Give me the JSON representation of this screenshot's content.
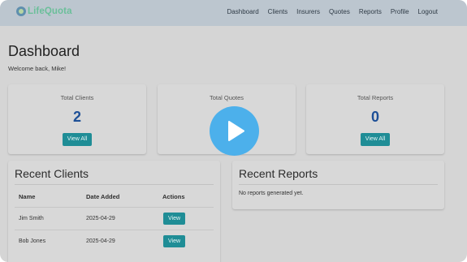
{
  "nav": {
    "logo": "LifeQuota",
    "links": [
      "Dashboard",
      "Clients",
      "Insurers",
      "Quotes",
      "Reports",
      "Profile",
      "Logout"
    ]
  },
  "page": {
    "title": "Dashboard",
    "welcome": "Welcome back, Mike!"
  },
  "stats": [
    {
      "label": "Total Clients",
      "value": "2",
      "button": "View All"
    },
    {
      "label": "Total Quotes",
      "value": "",
      "button": ""
    },
    {
      "label": "Total Reports",
      "value": "0",
      "button": "View All"
    }
  ],
  "recent_clients": {
    "title": "Recent Clients",
    "columns": [
      "Name",
      "Date Added",
      "Actions"
    ],
    "rows": [
      {
        "name": "Jim Smith",
        "date": "2025-04-29",
        "action": "View"
      },
      {
        "name": "Bob Jones",
        "date": "2025-04-29",
        "action": "View"
      }
    ]
  },
  "recent_reports": {
    "title": "Recent Reports",
    "empty": "No reports generated yet."
  },
  "overlay": {
    "icon": "play-icon",
    "color": "#45aeec"
  },
  "colors": {
    "accent": "#1f8d96",
    "stat_value": "#1d4f97",
    "nav_bg": "#bcc6cf"
  }
}
